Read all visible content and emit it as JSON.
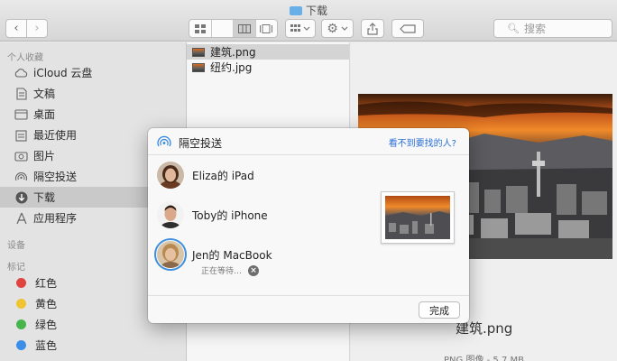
{
  "window": {
    "title": "下载"
  },
  "search": {
    "placeholder": "搜索"
  },
  "sidebar": {
    "favorites_header": "个人收藏",
    "favorites": [
      {
        "label": "iCloud 云盘",
        "icon": "cloud-icon"
      },
      {
        "label": "文稿",
        "icon": "document-icon"
      },
      {
        "label": "桌面",
        "icon": "desktop-icon"
      },
      {
        "label": "最近使用",
        "icon": "clock-icon"
      },
      {
        "label": "图片",
        "icon": "camera-icon"
      },
      {
        "label": "隔空投送",
        "icon": "airdrop-icon"
      },
      {
        "label": "下载",
        "icon": "download-icon",
        "selected": true
      },
      {
        "label": "应用程序",
        "icon": "applications-icon"
      }
    ],
    "devices_header": "设备",
    "tags_header": "标记",
    "tags": [
      {
        "label": "红色",
        "color": "#e0443e"
      },
      {
        "label": "黄色",
        "color": "#f0c330"
      },
      {
        "label": "绿色",
        "color": "#47b549"
      },
      {
        "label": "蓝色",
        "color": "#3b8ee8"
      }
    ]
  },
  "files": [
    {
      "name": "建筑.png",
      "selected": true
    },
    {
      "name": "纽约.jpg",
      "selected": false
    }
  ],
  "preview": {
    "name": "建筑.png",
    "info": "PNG 图像 - 5.7 MB"
  },
  "airdrop": {
    "title": "隔空投送",
    "help_link": "看不到要找的人?",
    "devices": [
      {
        "name": "Eliza的 iPad",
        "status": ""
      },
      {
        "name": "Toby的 iPhone",
        "status": ""
      },
      {
        "name": "Jen的 MacBook",
        "status": "正在等待…",
        "sending": true
      }
    ],
    "done_label": "完成"
  }
}
